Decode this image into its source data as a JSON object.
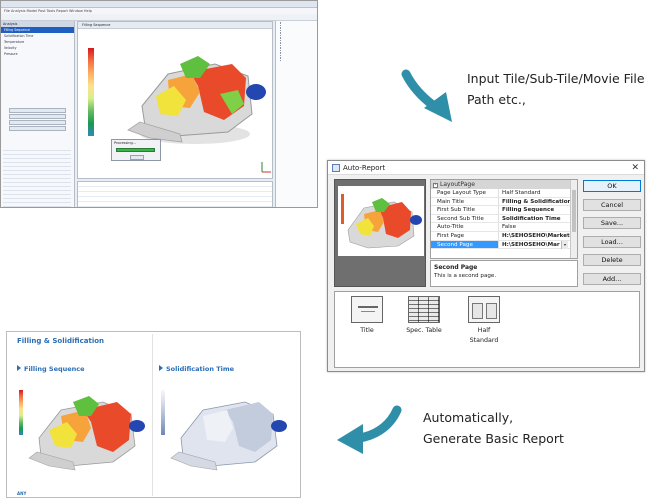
{
  "app_screenshot": {
    "menu": "File  Analysis  Model  Post  Tools  Report  Window  Help",
    "left_panel": {
      "header": "Analysis",
      "items": [
        "Filling Sequence",
        "Solidification Time",
        "Temperature",
        "Velocity",
        "Pressure"
      ],
      "selected_index": 0
    },
    "view_tab": "Filling Sequence",
    "progress_title": "Processing...",
    "progress_value": 0.92
  },
  "captions": {
    "top": [
      "Input Tile/Sub-Tile/Movie File",
      "Path etc.,"
    ],
    "bottom": [
      "Automatically,",
      "Generate Basic Report"
    ]
  },
  "dialog": {
    "title": "Auto-Report",
    "close_glyph": "✕",
    "category": "LayoutPage",
    "properties": [
      {
        "key": "Page Layout Type",
        "value": "Half Standard",
        "bold": false
      },
      {
        "key": "Main Title",
        "value": "Filling & Solidification",
        "bold": true
      },
      {
        "key": "First Sub Title",
        "value": "Filling Sequence",
        "bold": true
      },
      {
        "key": "Second Sub Title",
        "value": "Solidification Time",
        "bold": true
      },
      {
        "key": "Auto-Title",
        "value": "False",
        "bold": false
      },
      {
        "key": "First Page",
        "value": "H:\\SEHOSEHO\\Market",
        "bold": true
      },
      {
        "key": "Second Page",
        "value": "H:\\SEHOSEHO\\Mar",
        "bold": true
      }
    ],
    "selected_property_index": 6,
    "description_title": "Second Page",
    "description_text": "This is a second page.",
    "buttons": [
      "OK",
      "Cancel",
      "Save...",
      "Load...",
      "Delete",
      "Add..."
    ],
    "templates": [
      "Title",
      "Spec. Table",
      "Half Standard"
    ]
  },
  "report": {
    "main_title": "Filling & Solidification",
    "first_sub": "Filling Sequence",
    "second_sub": "Solidification Time"
  },
  "colors": {
    "arrow": "#2f8fa8",
    "accent": "#2a6db5",
    "selection": "#3399ff"
  }
}
